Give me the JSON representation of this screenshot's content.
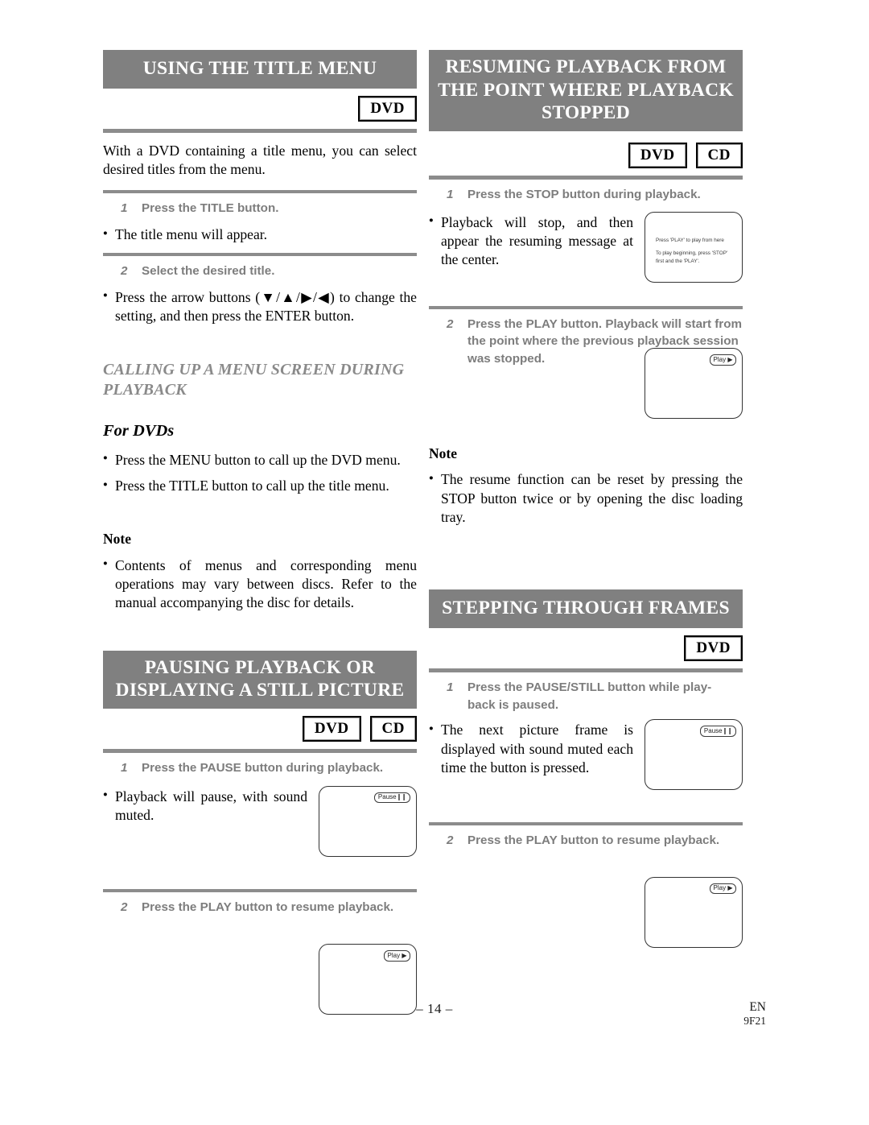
{
  "page": {
    "number": "– 14 –",
    "lang_code": "EN",
    "doc_code": "9F21"
  },
  "sections": {
    "title_menu": {
      "heading": "USING THE TITLE MENU",
      "badges": [
        "DVD"
      ],
      "intro": "With a DVD containing a title menu, you can select desired titles from the menu.",
      "step1_num": "1",
      "step1_text": "Press the TITLE button.",
      "step1_bullet": "The title menu will appear.",
      "step2_num": "2",
      "step2_text": "Select the desired title.",
      "step2_bullet": "Press the arrow buttons (▼/▲/▶/◀) to change the setting, and then press the ENTER button.",
      "subhead": "CALLING UP A MENU SCREEN DURING PLAYBACK",
      "for_dvds": "For DVDs",
      "dvd_bullet1": "Press the MENU button to call up the DVD menu.",
      "dvd_bullet2": "Press the TITLE button to call up the title menu.",
      "note_label": "Note",
      "note_text": "Contents of menus and corresponding menu operations may vary between discs. Refer to the manual accompanying the disc for details."
    },
    "resuming": {
      "heading": "RESUMING PLAYBACK FROM THE POINT WHERE PLAYBACK STOPPED",
      "badges": [
        "DVD",
        "CD"
      ],
      "step1_num": "1",
      "step1_text": "Press the STOP button during playback.",
      "step1_bullet": "Playback will stop, and then appear the resuming message at the center.",
      "osd_line1": "Press 'PLAY' to play from here",
      "osd_line2": "To play beginning, press 'STOP' first and the 'PLAY'.",
      "step2_num": "2",
      "step2_text": "Press the PLAY button. Playback will start from the point where the previous playback session was stopped.",
      "osd_play_label": "Play",
      "osd_play_glyph": "▶",
      "note_label": "Note",
      "note_text": "The resume function can be reset by pressing the STOP button twice or by opening the disc loading tray."
    },
    "pausing": {
      "heading": "PAUSING PLAYBACK OR DISPLAYING A STILL PICTURE",
      "badges": [
        "DVD",
        "CD"
      ],
      "step1_num": "1",
      "step1_text": "Press the PAUSE button during playback.",
      "step1_bullet": "Playback will pause, with sound muted.",
      "osd_pause_label": "Pause",
      "osd_pause_glyph": "❙❙",
      "step2_num": "2",
      "step2_text": "Press the PLAY button to resume playback.",
      "osd_play_label": "Play",
      "osd_play_glyph": "▶"
    },
    "stepping": {
      "heading": "STEPPING THROUGH FRAMES",
      "badges": [
        "DVD"
      ],
      "step1_num": "1",
      "step1_text": "Press the PAUSE/STILL button while play- back is paused.",
      "step1_bullet": "The next picture frame is displayed with sound muted each time the button is pressed.",
      "osd_pause_label": "Pause",
      "osd_pause_glyph": "❙❙",
      "step2_num": "2",
      "step2_text": "Press the PLAY button to resume playback.",
      "osd_play_label": "Play",
      "osd_play_glyph": "▶"
    }
  },
  "colors": {
    "header_gray": "#808080",
    "rule_gray": "#8c8c8c",
    "step_gray": "#7d7d7d"
  }
}
